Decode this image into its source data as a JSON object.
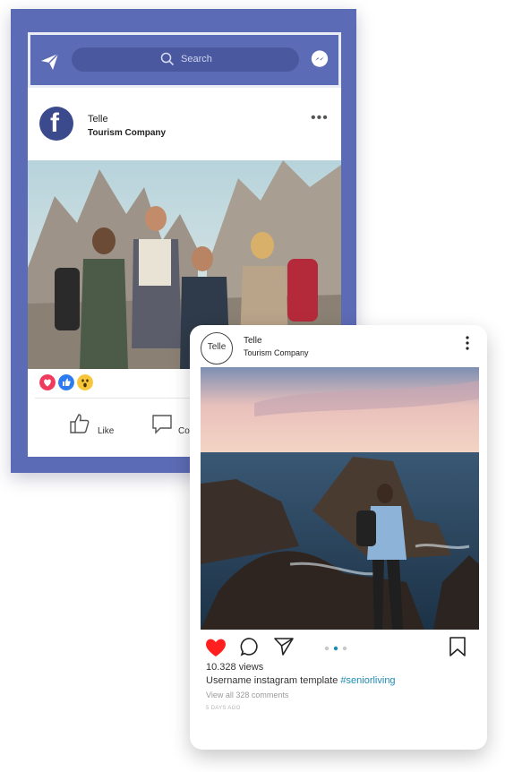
{
  "facebook_post": {
    "search_placeholder": "Search",
    "page_name": "Telle",
    "page_subtitle": "Tourism Company",
    "more_menu": "•••",
    "logo_letter": "f",
    "reactions": [
      "love-reaction",
      "like-reaction",
      "wow-reaction"
    ],
    "like_label": "Like",
    "comment_label": "Co"
  },
  "instagram_post": {
    "avatar_text": "Telle",
    "account_name": "Telle",
    "account_subtitle": "Tourism Company",
    "views": "10.328 views",
    "caption_text": "Username instagram template ",
    "caption_hashtag": "#seniorliving",
    "view_comments": "View all 328 comments",
    "time_ago": "5 DAYS AGO",
    "carousel_dots": 3,
    "carousel_active": 2
  },
  "colors": {
    "facebook_blue": "#5c6bb5",
    "like_red": "#ff1f1f",
    "hashtag_blue": "#1f8bb5"
  }
}
